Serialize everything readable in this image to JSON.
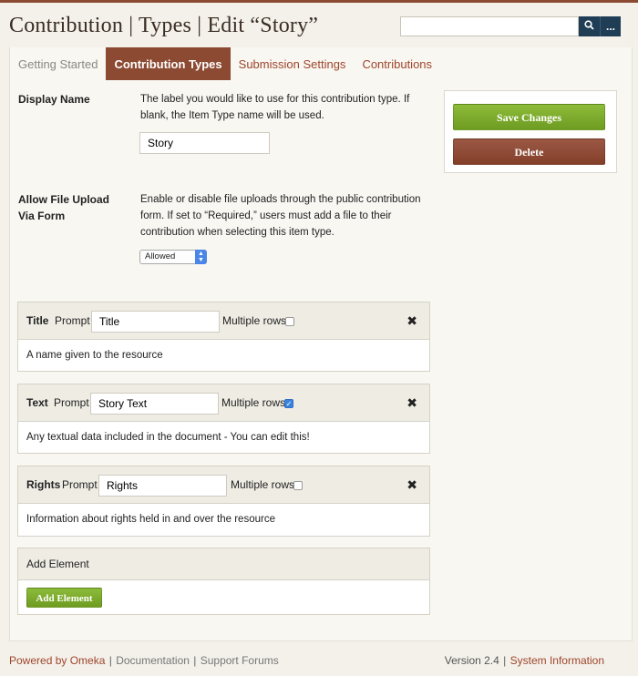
{
  "header": {
    "title": "Contribution | Types | Edit “Story”",
    "search": {
      "placeholder": "",
      "value": "",
      "submit_icon": "search-icon",
      "advanced_label": "..."
    }
  },
  "tabs": [
    {
      "label": "Getting Started",
      "active": false
    },
    {
      "label": "Contribution Types",
      "active": true
    },
    {
      "label": "Submission Settings",
      "active": false
    },
    {
      "label": "Contributions",
      "active": false
    }
  ],
  "form": {
    "display_name": {
      "label": "Display Name",
      "description": "The label you would like to use for this contribution type. If blank, the Item Type name will be used.",
      "value": "Story"
    },
    "file_upload": {
      "label": "Allow File Upload Via Form",
      "description": "Enable or disable file uploads through the public contribution form. If set to “Required,” users must add a file to their contribution when selecting this item type.",
      "selected": "Allowed"
    }
  },
  "actions": {
    "save_label": "Save Changes",
    "delete_label": "Delete"
  },
  "elements": [
    {
      "name": "Title",
      "prompt_label": "Prompt",
      "prompt_value": "Title",
      "multiple_label": "Multiple rows",
      "multiple_checked": false,
      "description": "A name given to the resource"
    },
    {
      "name": "Text",
      "prompt_label": "Prompt",
      "prompt_value": "Story Text",
      "multiple_label": "Multiple rows",
      "multiple_checked": true,
      "description": "Any textual data included in the document - You can edit this!"
    },
    {
      "name": "Rights",
      "prompt_label": "Prompt",
      "prompt_value": "Rights",
      "multiple_label": "Multiple rows",
      "multiple_checked": false,
      "description": "Information about rights held in and over the resource"
    }
  ],
  "add_element": {
    "heading": "Add Element",
    "button_label": "Add Element"
  },
  "footer": {
    "powered_by": "Powered by Omeka",
    "documentation": "Documentation",
    "support": "Support Forums",
    "separator": "|",
    "version": "Version 2.4",
    "system_info": "System Information"
  },
  "colors": {
    "brand": "#8c4a33",
    "link": "#a0452b",
    "save": "#7aa82c",
    "delete": "#8c4a33",
    "search_button": "#1f3d55"
  }
}
